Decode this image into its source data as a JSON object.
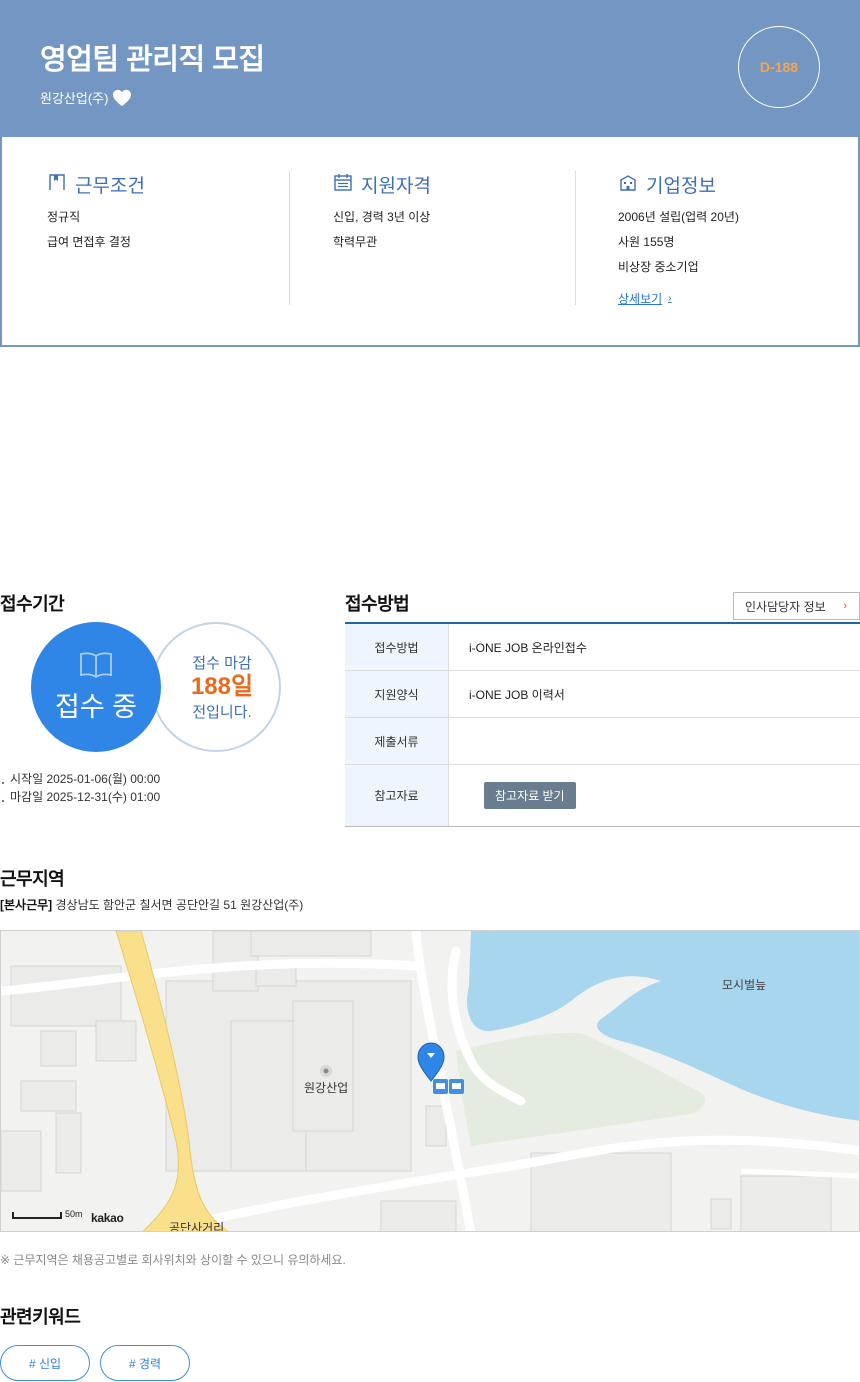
{
  "header": {
    "title": "영업팀 관리직 모집",
    "company": "원강산업(주)",
    "dday": "D-188",
    "colors": {
      "band": "#7397c2",
      "dday": "#f7a54b"
    }
  },
  "info": {
    "work_conditions": {
      "title": "근무조건",
      "lines": [
        "정규직",
        "급여 면접후 결정"
      ]
    },
    "qualifications": {
      "title": "지원자격",
      "lines": [
        "신입, 경력 3년 이상",
        "학력무관"
      ]
    },
    "company_info": {
      "title": "기업정보",
      "lines": [
        "2006년 설립(업력 20년)",
        "사원 155명",
        "비상장 중소기업"
      ],
      "link": "상세보기"
    }
  },
  "period": {
    "title": "접수기간",
    "status": "접수 중",
    "deadline_prefix": "접수 마감",
    "days_left": "188일",
    "deadline_suffix": "전입니다.",
    "start": "시작일 2025-01-06(월) 00:00",
    "end": "마감일 2025-12-31(수) 01:00"
  },
  "method": {
    "title": "접수방법",
    "hr_button": "인사담당자 정보",
    "rows": [
      {
        "label": "접수방법",
        "value": "i-ONE JOB 온라인접수"
      },
      {
        "label": "지원양식",
        "value": "i-ONE JOB 이력서"
      },
      {
        "label": "제출서류",
        "value": ""
      },
      {
        "label": "참고자료",
        "button": "참고자료 받기"
      }
    ]
  },
  "location": {
    "title": "근무지역",
    "tag": "[본사근무]",
    "address": "경상남도 함안군 칠서면 공단안길 51 원강산업(주)",
    "map": {
      "label_company": "원강산업",
      "label_lake": "모시벌늪",
      "label_intersection": "공단사거리",
      "scale": "50m",
      "brand": "kakao"
    },
    "notice": "※ 근무지역은 채용공고별로 회사위치와 상이할 수 있으니 유의하세요."
  },
  "keywords": {
    "title": "관련키워드",
    "items": [
      "# 신입",
      "# 경력"
    ]
  }
}
